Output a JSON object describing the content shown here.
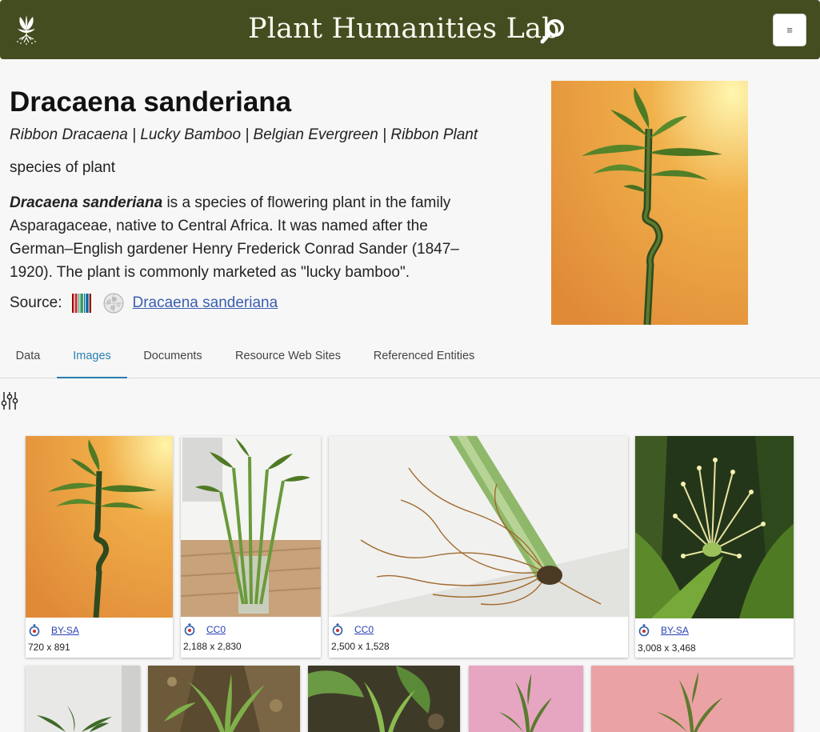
{
  "header": {
    "site_title": "Plant Humanities Lab",
    "logo_icon": "plant-roots-logo",
    "search_icon": "search-icon",
    "menu_icon": "≡",
    "bar_color": "#444d20"
  },
  "entity": {
    "title": "Dracaena sanderiana",
    "common_names": "Ribbon Dracaena | Lucky Bamboo | Belgian Evergreen | Ribbon Plant",
    "kind": "species of plant",
    "description_bold": "Dracaena sanderiana",
    "description_rest": " is a species of flowering plant in the family Asparagaceae, native to Central Africa. It was named after the German–English gardener Henry Frederick Conrad Sander (1847–1920). The plant is commonly marketed as \"lucky bamboo\".",
    "source_label": "Source:",
    "source_link": "Dracaena sanderiana"
  },
  "tabs": [
    {
      "label": "Data"
    },
    {
      "label": "Images"
    },
    {
      "label": "Documents"
    },
    {
      "label": "Resource Web Sites"
    },
    {
      "label": "Referenced Entities"
    }
  ],
  "active_tab": "Images",
  "gallery": [
    {
      "license": "BY-SA",
      "dims": "720 x 891"
    },
    {
      "license": "CC0",
      "dims": "2,188 x 2,830"
    },
    {
      "license": "CC0",
      "dims": "2,500 x 1,528"
    },
    {
      "license": "BY-SA",
      "dims": "3,008 x 3,468"
    }
  ],
  "colors": {
    "accent": "#2a7fb0",
    "link": "#3a5fb0"
  }
}
